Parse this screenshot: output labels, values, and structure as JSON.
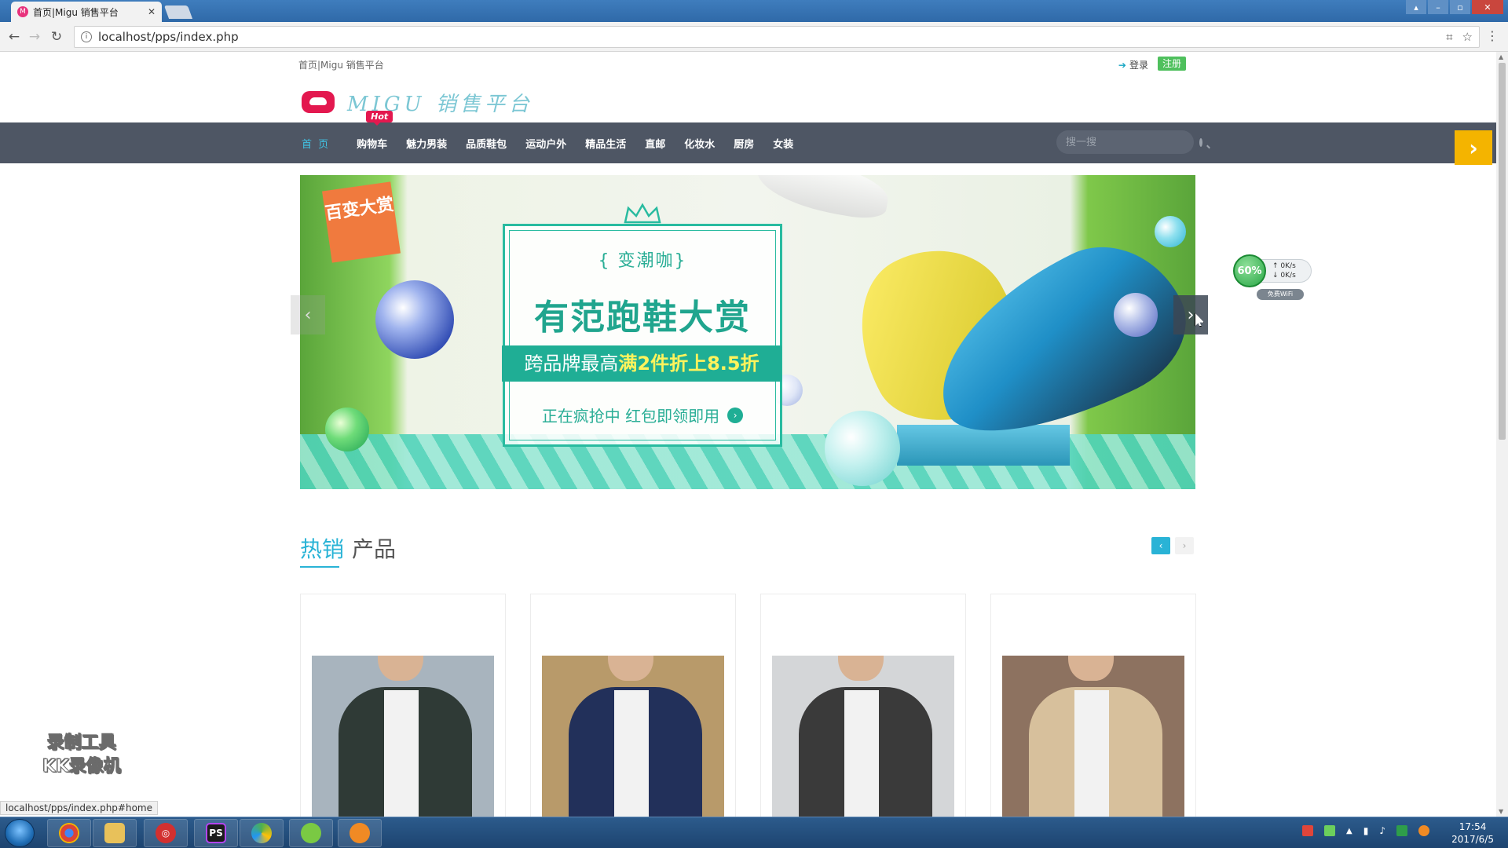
{
  "browser": {
    "tab_title": "首页|Migu 销售平台",
    "tab_favicon": "M",
    "url": "localhost/pps/index.php",
    "status_url": "localhost/pps/index.php#home"
  },
  "header": {
    "breadcrumb": "首页|Migu 销售平台",
    "login_label": "登录",
    "register_label": "注册",
    "logo_text": "MIGU 销售平台"
  },
  "nav": {
    "items": [
      {
        "label": "首 页"
      },
      {
        "label": "购物车"
      },
      {
        "label": "魅力男装"
      },
      {
        "label": "品质鞋包"
      },
      {
        "label": "运动户外"
      },
      {
        "label": "精品生活"
      },
      {
        "label": "直邮"
      },
      {
        "label": "化妆水"
      },
      {
        "label": "厨房"
      },
      {
        "label": "女装"
      }
    ],
    "hot_badge": "Hot",
    "search_placeholder": "搜一搜"
  },
  "banner": {
    "tag": "百变大赏",
    "subtitle": "{ 变潮咖}",
    "title": "有范跑鞋大赏",
    "strip_prefix": "跨品牌最高",
    "strip_highlight": "满2件折上8.5折",
    "cta": "正在疯抢中 红包即领即用"
  },
  "net_widget": {
    "percent": "60%",
    "up_speed": "0K/s",
    "down_speed": "0K/s",
    "wifi_label": "免费WiFi"
  },
  "hot_products": {
    "title_highlight": "热销",
    "title_rest": "产品",
    "products": [
      {
        "jacket_color": "#2f3a36",
        "bg": "#a8b4be"
      },
      {
        "jacket_color": "#22305a",
        "bg": "#b89a6a"
      },
      {
        "jacket_color": "#3a3a3a",
        "bg": "#d4d6d8"
      },
      {
        "jacket_color": "#d7c09c",
        "bg": "#8d7260"
      }
    ]
  },
  "watermark": {
    "line1": "录制工具",
    "line2": "KK录像机"
  },
  "taskbar": {
    "time": "17:54",
    "date": "2017/6/5"
  },
  "colors": {
    "nav_bg": "#4e5664",
    "accent": "#29b3d6",
    "register": "#4fc05d",
    "hot": "#e3184f"
  }
}
